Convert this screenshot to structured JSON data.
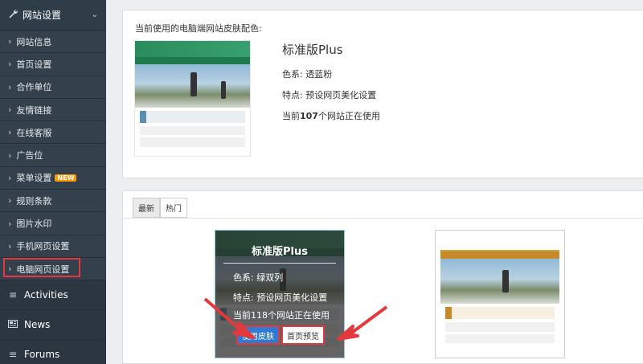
{
  "sidebar": {
    "header": {
      "label": "网站设置"
    },
    "items": [
      {
        "label": "网站信息"
      },
      {
        "label": "首页设置"
      },
      {
        "label": "合作单位"
      },
      {
        "label": "友情链接"
      },
      {
        "label": "在线客服"
      },
      {
        "label": "广告位"
      },
      {
        "label": "菜单设置",
        "badge": "NEW"
      },
      {
        "label": "规则条款"
      },
      {
        "label": "图片水印"
      },
      {
        "label": "手机网页设置"
      },
      {
        "label": "电脑网页设置"
      }
    ],
    "sections": [
      {
        "label": "Activities",
        "icon": "list-icon"
      },
      {
        "label": "News",
        "icon": "newspaper-icon"
      },
      {
        "label": "Forums",
        "icon": "list-icon"
      }
    ]
  },
  "current_skin": {
    "heading": "当前使用的电脑端网站皮肤配色:",
    "name": "标准版Plus",
    "color": "色系: 透蓝粉",
    "feature": "特点: 预设网页美化设置",
    "usage_prefix": "当前",
    "usage_count": "107",
    "usage_suffix": "个网站正在使用"
  },
  "tabs": [
    {
      "label": "最新",
      "active": true
    },
    {
      "label": "热门",
      "active": false
    }
  ],
  "skin_card": {
    "name": "标准版Plus",
    "color": "色系: 绿双列",
    "feature": "特点: 预设网页美化设置",
    "usage": "当前118个网站正在使用",
    "use_button": "使用皮肤",
    "preview_button": "首页预览"
  },
  "colors": {
    "sidebar_bg": "#2b3640",
    "highlight": "#e4393c",
    "primary_button": "#2f7ad2",
    "badge": "#ff9a00"
  }
}
